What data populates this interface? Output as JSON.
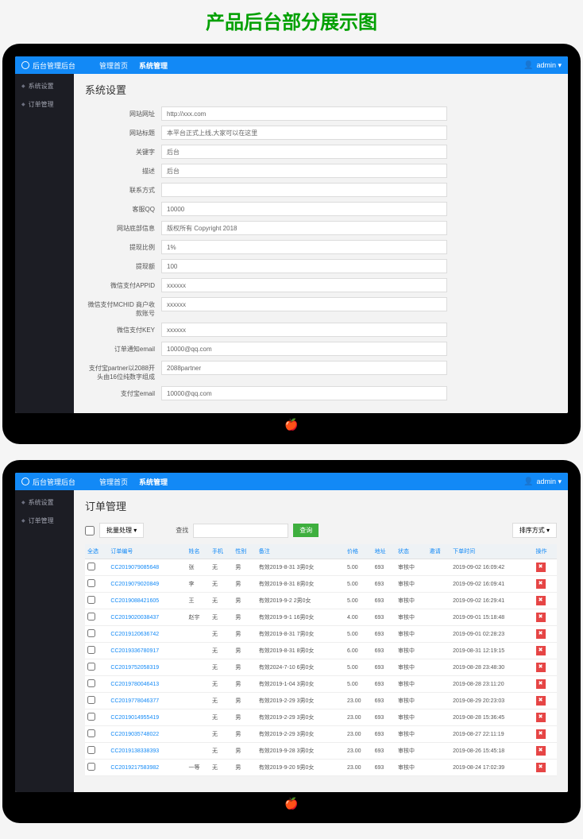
{
  "page_heading": "产品后台部分展示图",
  "header": {
    "brand": "后台管理后台",
    "nav": [
      "管理首页",
      "系统管理"
    ],
    "user": "admin ▾"
  },
  "sidebar": {
    "items": [
      "系统设置",
      "订单管理"
    ]
  },
  "settings": {
    "title": "系统设置",
    "fields": [
      {
        "label": "网站网址",
        "value": "http://xxx.com"
      },
      {
        "label": "网站标题",
        "value": "本平台正式上线,大家可以在这里"
      },
      {
        "label": "关键字",
        "value": "后台"
      },
      {
        "label": "描述",
        "value": "后台"
      },
      {
        "label": "联系方式",
        "value": ""
      },
      {
        "label": "客服QQ",
        "value": "10000"
      },
      {
        "label": "网站底部信息",
        "value": "版权所有 Copyright 2018"
      },
      {
        "label": "提现比例",
        "value": "1%"
      },
      {
        "label": "提现额",
        "value": "100"
      },
      {
        "label": "微信支付APPID",
        "value": "xxxxxx"
      },
      {
        "label": "微信支付MCHID 商户收款账号",
        "value": "xxxxxx"
      },
      {
        "label": "微信支付KEY",
        "value": "xxxxxx"
      },
      {
        "label": "订单通知email",
        "value": "10000@qq.com"
      },
      {
        "label": "支付宝partner以2088开头由16位纯数字组成",
        "value": "2088partner"
      },
      {
        "label": "支付宝email",
        "value": "10000@qq.com"
      }
    ]
  },
  "orders": {
    "title": "订单管理",
    "toolbar": {
      "bulk_label": "批量处理 ▾",
      "search_label": "查找",
      "search_placeholder": "",
      "search_btn": "查询",
      "sort_label": "排序方式 ▾"
    },
    "columns": [
      "全选",
      "订单编号",
      "姓名",
      "手机",
      "性别",
      "备注",
      "价格",
      "地址",
      "状态",
      "邀请",
      "下单时间",
      "操作"
    ],
    "rows": [
      {
        "no": "CC2019079085648",
        "name": "张",
        "phone": "无",
        "gender": "男",
        "note": "有效2019-8-31 3男0女",
        "price": "5.00",
        "addr": "693",
        "status": "审核中",
        "invite": "",
        "time": "2019-09-02 16:09:42"
      },
      {
        "no": "CC2019079020849",
        "name": "李",
        "phone": "无",
        "gender": "男",
        "note": "有效2019-8-31 8男0女",
        "price": "5.00",
        "addr": "693",
        "status": "审核中",
        "invite": "",
        "time": "2019-09-02 16:09:41"
      },
      {
        "no": "CC2019088421605",
        "name": "王",
        "phone": "无",
        "gender": "男",
        "note": "有效2019-9-2 2男0女",
        "price": "5.00",
        "addr": "693",
        "status": "审核中",
        "invite": "",
        "time": "2019-09-02 16:29:41"
      },
      {
        "no": "CC2019020038437",
        "name": "赵宇",
        "phone": "无",
        "gender": "男",
        "note": "有效2019-9-1 16男0女",
        "price": "4.00",
        "addr": "693",
        "status": "审核中",
        "invite": "",
        "time": "2019-09-01 15:18:48"
      },
      {
        "no": "CC2019120636742",
        "name": "",
        "phone": "无",
        "gender": "男",
        "note": "有效2019-8-31 7男0女",
        "price": "5.00",
        "addr": "693",
        "status": "审核中",
        "invite": "",
        "time": "2019-09-01 02:28:23"
      },
      {
        "no": "CC2019336780917",
        "name": "",
        "phone": "无",
        "gender": "男",
        "note": "有效2019-8-31 8男0女",
        "price": "6.00",
        "addr": "693",
        "status": "审核中",
        "invite": "",
        "time": "2019-08-31 12:19:15"
      },
      {
        "no": "CC2019752058319",
        "name": "",
        "phone": "无",
        "gender": "男",
        "note": "有效2024-7-10 6男0女",
        "price": "5.00",
        "addr": "693",
        "status": "审核中",
        "invite": "",
        "time": "2019-08-28 23:48:30"
      },
      {
        "no": "CC2019780046413",
        "name": "",
        "phone": "无",
        "gender": "男",
        "note": "有效2019-1-04 3男0女",
        "price": "5.00",
        "addr": "693",
        "status": "审核中",
        "invite": "",
        "time": "2019-08-28 23:11:20"
      },
      {
        "no": "CC2019778046377",
        "name": "",
        "phone": "无",
        "gender": "男",
        "note": "有效2019-2-29 3男0女",
        "price": "23.00",
        "addr": "693",
        "status": "审核中",
        "invite": "",
        "time": "2019-08-29 20:23:03"
      },
      {
        "no": "CC2019014955419",
        "name": "",
        "phone": "无",
        "gender": "男",
        "note": "有效2019-2-29 3男0女",
        "price": "23.00",
        "addr": "693",
        "status": "审核中",
        "invite": "",
        "time": "2019-08-28 15:36:45"
      },
      {
        "no": "CC2019035748022",
        "name": "",
        "phone": "无",
        "gender": "男",
        "note": "有效2019-2-29 3男0女",
        "price": "23.00",
        "addr": "693",
        "status": "审核中",
        "invite": "",
        "time": "2019-08-27 22:11:19"
      },
      {
        "no": "CC2019138338393",
        "name": "",
        "phone": "无",
        "gender": "男",
        "note": "有效2019-9-28 3男0女",
        "price": "23.00",
        "addr": "693",
        "status": "审核中",
        "invite": "",
        "time": "2019-08-26 15:45:18"
      },
      {
        "no": "CC2019217583982",
        "name": "一等",
        "phone": "无",
        "gender": "男",
        "note": "有效2019-9-20 9男0女",
        "price": "23.00",
        "addr": "693",
        "status": "审核中",
        "invite": "",
        "time": "2019-08-24 17:02:39"
      }
    ]
  }
}
